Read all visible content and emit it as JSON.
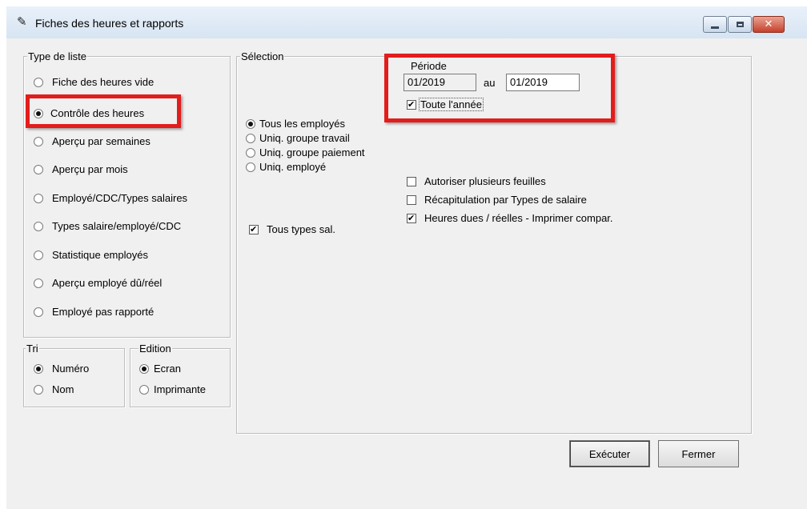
{
  "window": {
    "title": "Fiches des heures et rapports",
    "icon": "paperclip-icon"
  },
  "type_de_liste": {
    "legend": "Type de liste",
    "options": [
      {
        "label": "Fiche des heures vide",
        "selected": false
      },
      {
        "label": "Contrôle des heures",
        "selected": true
      },
      {
        "label": "Aperçu par semaines",
        "selected": false
      },
      {
        "label": "Aperçu par mois",
        "selected": false
      },
      {
        "label": "Employé/CDC/Types salaires",
        "selected": false
      },
      {
        "label": "Types salaire/employé/CDC",
        "selected": false
      },
      {
        "label": "Statistique employés",
        "selected": false
      },
      {
        "label": "Aperçu employé dû/réel",
        "selected": false
      },
      {
        "label": "Employé pas rapporté",
        "selected": false
      }
    ]
  },
  "tri": {
    "legend": "Tri",
    "options": [
      {
        "label": "Numéro",
        "selected": true
      },
      {
        "label": "Nom",
        "selected": false
      }
    ]
  },
  "edition": {
    "legend": "Edition",
    "options": [
      {
        "label": "Ecran",
        "selected": true
      },
      {
        "label": "Imprimante",
        "selected": false
      }
    ]
  },
  "selection": {
    "legend": "Sélection",
    "periode": {
      "label": "Période",
      "from": "01/2019",
      "to_label": "au",
      "to": "01/2019",
      "whole_year": {
        "label": "Toute l'année",
        "checked": true
      }
    },
    "employees": [
      {
        "label": "Tous les employés",
        "selected": true
      },
      {
        "label": "Uniq. groupe travail",
        "selected": false
      },
      {
        "label": "Uniq. groupe paiement",
        "selected": false
      },
      {
        "label": "Uniq. employé",
        "selected": false
      }
    ],
    "tous_types": {
      "label": "Tous types sal.",
      "checked": true
    },
    "options": [
      {
        "label": "Autoriser plusieurs feuilles",
        "checked": false
      },
      {
        "label": "Récapitulation par Types de salaire",
        "checked": false
      },
      {
        "label": "Heures dues / réelles - Imprimer compar.",
        "checked": true
      }
    ]
  },
  "buttons": {
    "execute": "Exécuter",
    "close": "Fermer"
  },
  "colors": {
    "highlight": "#e31c1c",
    "dialog_bg": "#f0f0f0",
    "titlebar": "#d7e4f2"
  }
}
